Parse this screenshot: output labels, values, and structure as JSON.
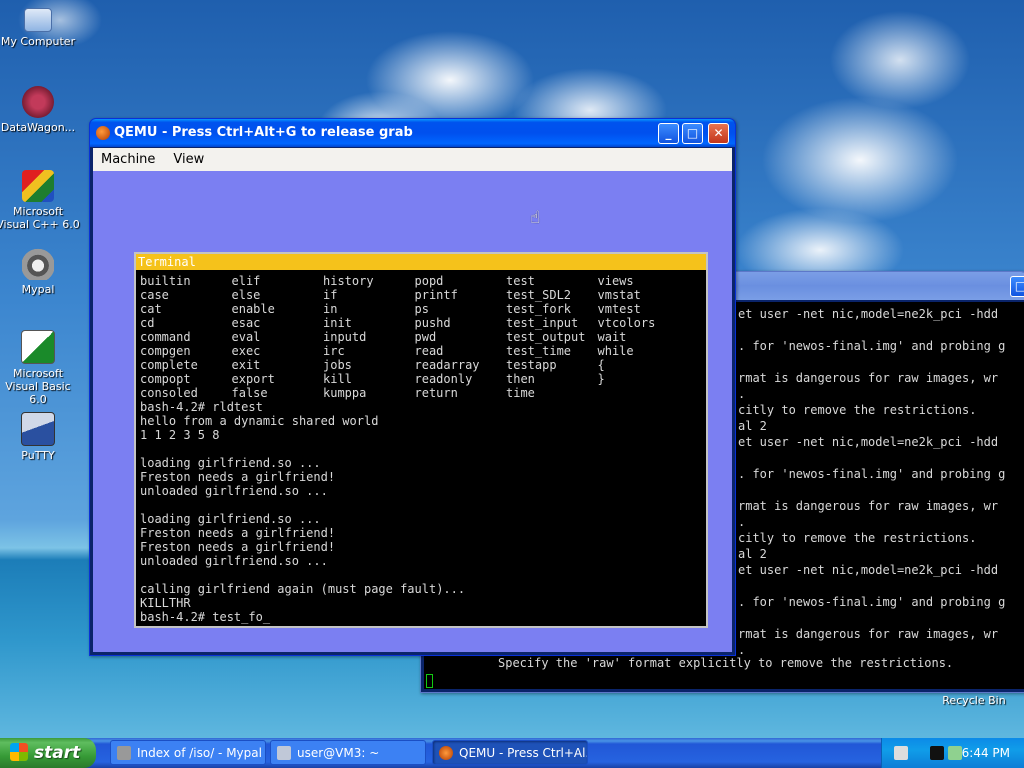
{
  "desktop": {
    "icons": [
      {
        "label": "My Computer"
      },
      {
        "label": "DataWagon..."
      },
      {
        "label": "Microsoft Visual C++ 6.0"
      },
      {
        "label": "Mypal"
      },
      {
        "label": "Microsoft Visual Basic 6.0"
      },
      {
        "label": "PuTTY"
      },
      {
        "label": "Recycle Bin"
      }
    ]
  },
  "qemu": {
    "title": "QEMU - Press Ctrl+Alt+G to release grab",
    "menu": [
      "Machine",
      "View"
    ],
    "terminal": {
      "title": "Terminal",
      "command_columns": [
        [
          "builtin",
          "case",
          "cat",
          "cd",
          "command",
          "compgen",
          "complete",
          "compopt",
          "consoled"
        ],
        [
          "elif",
          "else",
          "enable",
          "esac",
          "eval",
          "exec",
          "exit",
          "export",
          "false"
        ],
        [
          "history",
          "if",
          "in",
          "init",
          "inputd",
          "irc",
          "jobs",
          "kill",
          "kumppa"
        ],
        [
          "popd",
          "printf",
          "ps",
          "pushd",
          "pwd",
          "read",
          "readarray",
          "readonly",
          "return"
        ],
        [
          "test",
          "test_SDL2",
          "test_fork",
          "test_input",
          "test_output",
          "test_time",
          "testapp",
          "then",
          "time"
        ],
        [
          "views",
          "vmstat",
          "vmtest",
          "vtcolors",
          "wait",
          "while",
          "{",
          "}",
          ""
        ]
      ],
      "output": [
        "bash-4.2# rldtest",
        "hello from a dynamic shared world",
        "1 1 2 3 5 8",
        "",
        "loading girlfriend.so ...",
        "Freston needs a girlfriend!",
        "unloaded girlfriend.so ...",
        "",
        "loading girlfriend.so ...",
        "Freston needs a girlfriend!",
        "Freston needs a girlfriend!",
        "unloaded girlfriend.so ...",
        "",
        "calling girlfriend again (must page fault)...",
        "KILLTHR",
        "bash-4.2# test_fo_"
      ]
    }
  },
  "background_terminal": {
    "lines": [
      "et user -net nic,model=ne2k_pci -hdd",
      "",
      ". for 'newos-final.img' and probing g",
      "",
      "rmat is dangerous for raw images, wr",
      ".",
      "citly to remove the restrictions.",
      "al 2",
      "et user -net nic,model=ne2k_pci -hdd",
      "",
      ". for 'newos-final.img' and probing g",
      "",
      "rmat is dangerous for raw images, wr",
      ".",
      "citly to remove the restrictions.",
      "al 2",
      "et user -net nic,model=ne2k_pci -hdd",
      "",
      ". for 'newos-final.img' and probing g",
      "",
      "rmat is dangerous for raw images, wr",
      "."
    ],
    "last_line": "Specify the 'raw' format explicitly to remove the restrictions."
  },
  "taskbar": {
    "start_label": "start",
    "tasks": [
      {
        "label": "Index of /iso/ - Mypal"
      },
      {
        "label": "user@VM3: ~"
      },
      {
        "label": "QEMU - Press Ctrl+Al..."
      }
    ],
    "clock": "6:44 PM"
  },
  "colors": {
    "qemu_screen_bg": "#7b7ff2",
    "terminal_header": "#f5c21b",
    "xp_titlebar": "#0053ee"
  }
}
